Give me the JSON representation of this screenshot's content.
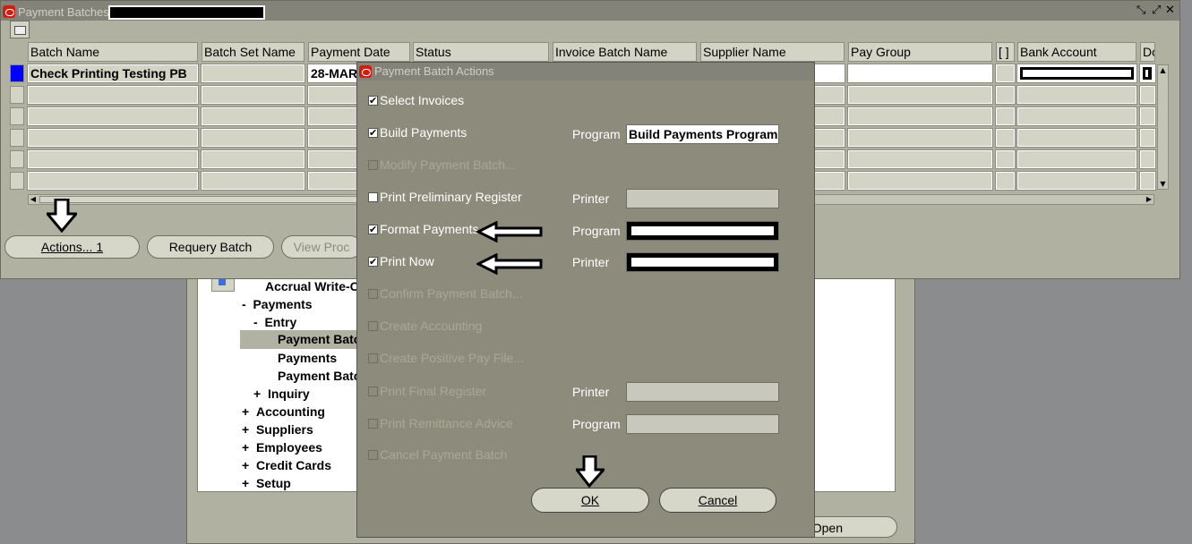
{
  "main_window": {
    "title": "Payment Batches",
    "columns": [
      "Batch Name",
      "Batch Set Name",
      "Payment Date",
      "Status",
      "Invoice Batch Name",
      "Supplier Name",
      "Pay Group",
      "[ ]",
      "Bank Account",
      "Do"
    ],
    "row1": {
      "batch_name": "Check Printing Testing PB",
      "payment_date": "28-MAR-"
    },
    "buttons": {
      "actions": "Actions... 1",
      "requery": "Requery Batch",
      "view": "View Proc"
    }
  },
  "navigator": {
    "items": [
      "Accrual Write-O",
      "Payments",
      "Entry",
      "Payment Batc",
      "Payments",
      "Payment Batc",
      "Inquiry",
      "Accounting",
      "Suppliers",
      "Employees",
      "Credit Cards",
      "Setup"
    ],
    "prefixes": [
      "",
      "-",
      "-",
      "",
      "",
      "",
      "+",
      "+",
      "+",
      "+",
      "+",
      "+"
    ],
    "open_button": "Open"
  },
  "dialog": {
    "title": "Payment Batch Actions",
    "options": [
      {
        "label": "Select Invoices",
        "checked": true,
        "enabled": true
      },
      {
        "label": "Build Payments",
        "checked": true,
        "enabled": true
      },
      {
        "label": "Modify Payment Batch...",
        "checked": false,
        "enabled": false
      },
      {
        "label": "Print Preliminary Register",
        "checked": false,
        "enabled": true
      },
      {
        "label": "Format Payments",
        "checked": true,
        "enabled": true
      },
      {
        "label": "Print Now",
        "checked": true,
        "enabled": true
      },
      {
        "label": "Confirm Payment Batch...",
        "checked": false,
        "enabled": false
      },
      {
        "label": "Create Accounting",
        "checked": false,
        "enabled": false
      },
      {
        "label": "Create Positive Pay File...",
        "checked": false,
        "enabled": false
      },
      {
        "label": "Print Final Register",
        "checked": false,
        "enabled": false
      },
      {
        "label": "Print Remittance Advice",
        "checked": false,
        "enabled": false
      },
      {
        "label": "Cancel Payment Batch",
        "checked": false,
        "enabled": false
      }
    ],
    "param_labels": {
      "program": "Program",
      "printer": "Printer"
    },
    "build_program_value": "Build Payments Program",
    "ok": "OK",
    "cancel": "Cancel"
  },
  "colors": {
    "window_bg": "#b1b1a2",
    "dialog_bg": "#8d8c7c",
    "desktop": "#8a8c8d",
    "title_bar": "#83837a",
    "current_record": "#0000ff"
  }
}
